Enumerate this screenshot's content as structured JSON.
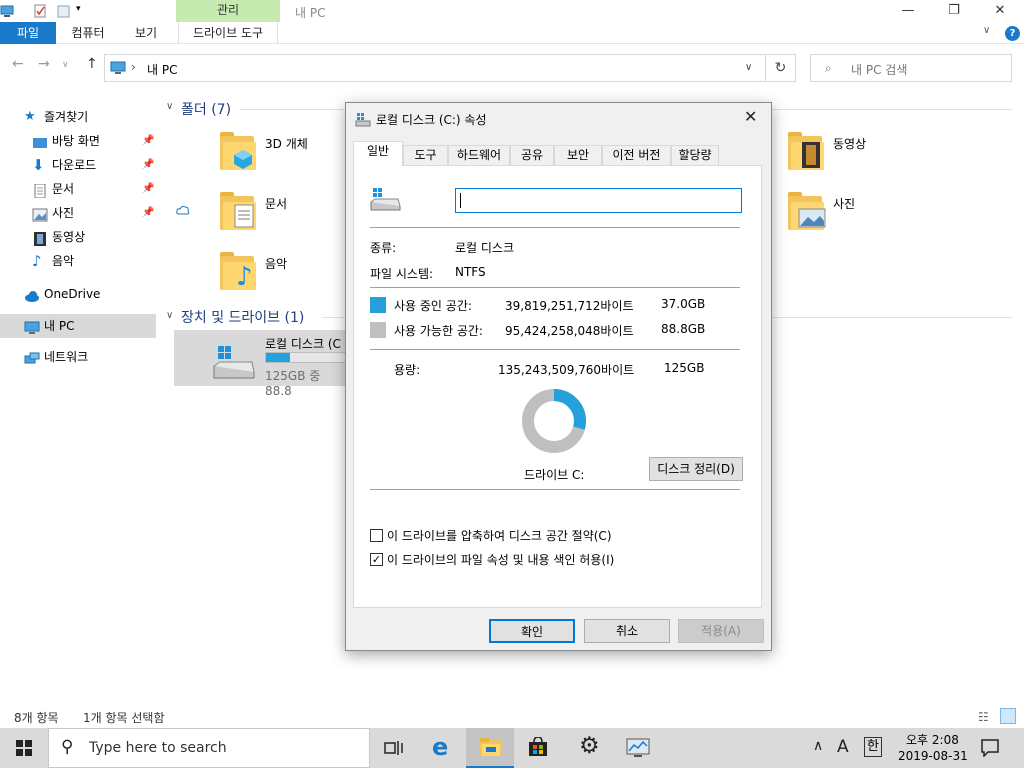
{
  "ribbon": {
    "context_tab": "관리",
    "window_title": "내 PC",
    "tabs": [
      "파일",
      "컴퓨터",
      "보기",
      "드라이브 도구"
    ]
  },
  "address": {
    "path": "내 PC",
    "search_placeholder": "내 PC 검색"
  },
  "nav": {
    "quick_access": "즐겨찾기",
    "items": [
      "바탕 화면",
      "다운로드",
      "문서",
      "사진",
      "동영상",
      "음악"
    ],
    "onedrive": "OneDrive",
    "this_pc": "내 PC",
    "network": "네트워크"
  },
  "content": {
    "folders_header": "폴더 (7)",
    "folders": [
      "3D 개체",
      "문서",
      "음악",
      "동영상",
      "사진"
    ],
    "devices_header": "장치 및 드라이브 (1)",
    "drive_name": "로컬 디스크 (C",
    "drive_usage": "125GB 중 88.8",
    "drive_used_fraction": 0.3
  },
  "status": {
    "count": "8개 항목",
    "selected": "1개 항목 선택함"
  },
  "taskbar": {
    "search_placeholder": "Type here to search",
    "time": "오후 2:08",
    "date": "2019-08-31",
    "ime_lang": "A",
    "ime_mode": "한"
  },
  "dialog": {
    "title": "로컬 디스크 (C:) 속성",
    "tabs": [
      "일반",
      "도구",
      "하드웨어",
      "공유",
      "보안",
      "이전 버전",
      "할당량"
    ],
    "name_value": "",
    "type_label": "종류:",
    "type_value": "로컬 디스크",
    "fs_label": "파일 시스템:",
    "fs_value": "NTFS",
    "used_label": "사용 중인 공간:",
    "used_bytes": "39,819,251,712바이트",
    "used_gb": "37.0GB",
    "free_label": "사용 가능한 공간:",
    "free_bytes": "95,424,258,048바이트",
    "free_gb": "88.8GB",
    "capacity_label": "용량:",
    "capacity_bytes": "135,243,509,760바이트",
    "capacity_gb": "125GB",
    "drive_label": "드라이브 C:",
    "cleanup_button": "디스크 정리(D)",
    "compress_label": "이 드라이브를 압축하여 디스크 공간 절약(C)",
    "compress_checked": false,
    "index_label": "이 드라이브의 파일 속성 및 내용 색인 허용(I)",
    "index_checked": true,
    "ok": "확인",
    "cancel": "취소",
    "apply": "적용(A)",
    "used_fraction": 0.294
  },
  "colors": {
    "used": "#26a0da",
    "free": "#bfbfbf",
    "accent": "#1979ca",
    "context_tab": "#c7eab0"
  }
}
